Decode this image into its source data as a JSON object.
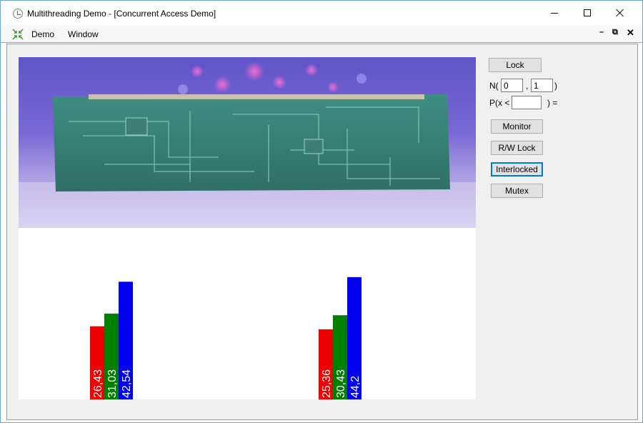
{
  "window": {
    "title": "Multithreading Demo - [Concurrent Access Demo]"
  },
  "menu": {
    "items": [
      "Demo",
      "Window"
    ]
  },
  "controls": {
    "lock_label": "Lock",
    "n_prefix": "N(",
    "n_value_1": "0",
    "n_comma": ",",
    "n_value_2": "1",
    "n_suffix": ")",
    "p_prefix": "P(x <",
    "p_value": "",
    "p_suffix": ") =",
    "monitor_label": "Monitor",
    "rwlock_label": "R/W Lock",
    "interlocked_label": "Interlocked",
    "mutex_label": "Mutex"
  },
  "colors": {
    "series1": "#ee0000",
    "series2": "#008000",
    "series3": "#0000ee"
  },
  "chart_data": {
    "type": "bar",
    "categories": [
      "",
      ""
    ],
    "series": [
      {
        "values": [
          26.43,
          25.36
        ],
        "labels": [
          "26,43",
          "25,36"
        ]
      },
      {
        "values": [
          31.03,
          30.43
        ],
        "labels": [
          "31,03",
          "30,43"
        ]
      },
      {
        "values": [
          42.54,
          44.2
        ],
        "labels": [
          "42,54",
          "44,2"
        ]
      }
    ],
    "ylim": [
      0,
      62
    ],
    "grid": false,
    "legend": "none"
  }
}
